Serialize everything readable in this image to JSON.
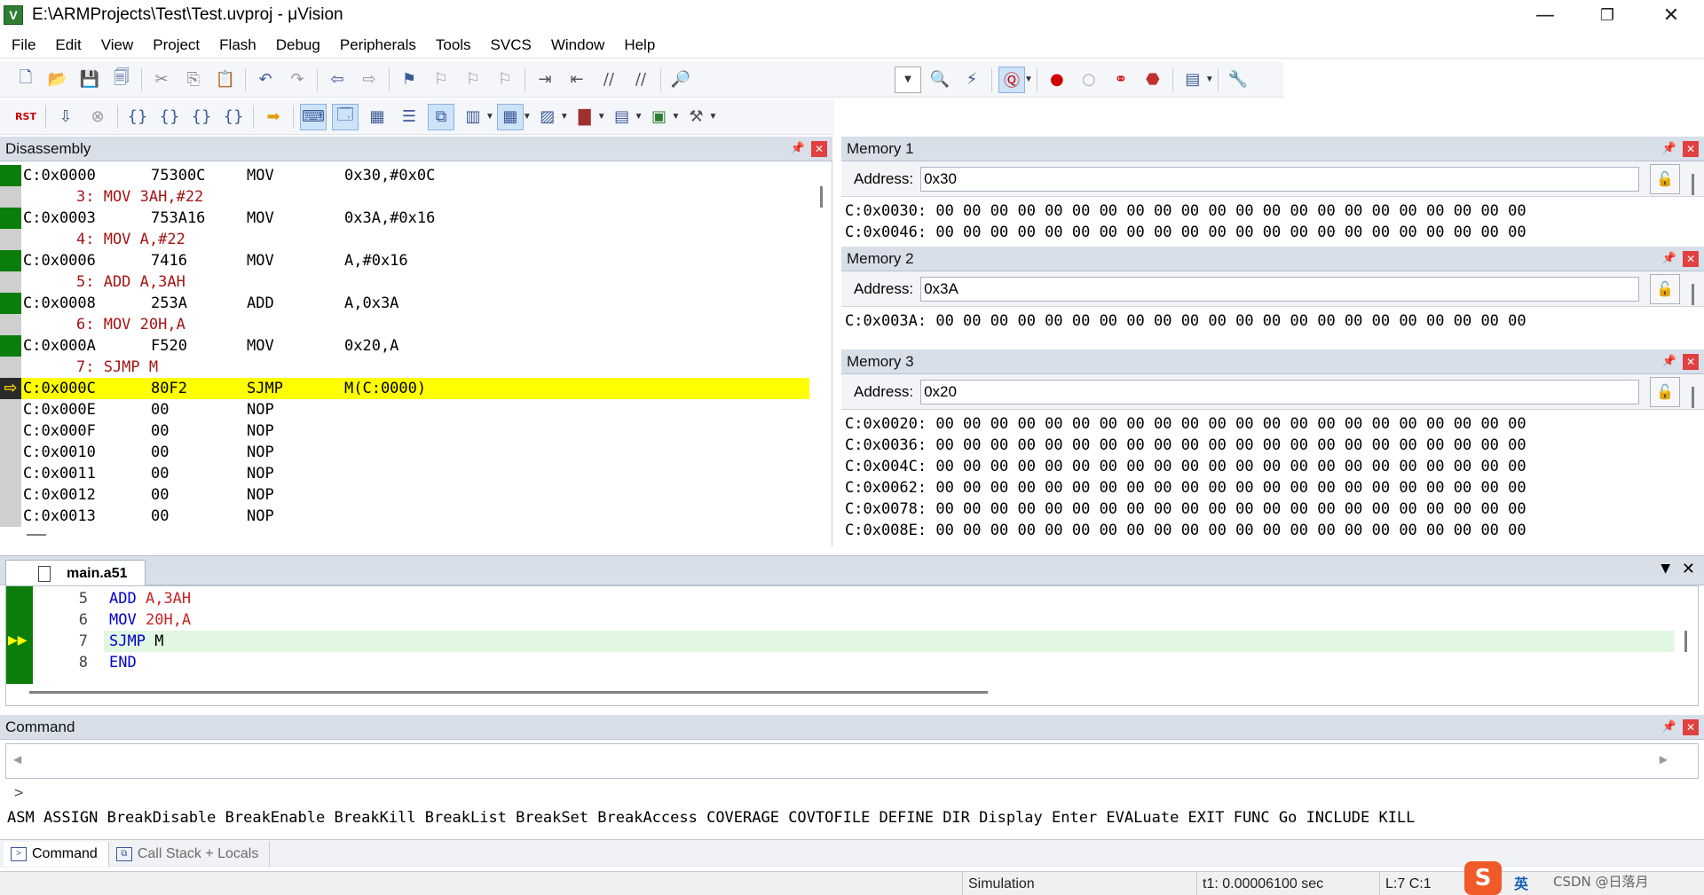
{
  "window": {
    "title": "E:\\ARMProjects\\Test\\Test.uvproj - μVision",
    "controls": {
      "minimize": "—",
      "maximize": "❐",
      "close": "✕"
    }
  },
  "menu": [
    "File",
    "Edit",
    "View",
    "Project",
    "Flash",
    "Debug",
    "Peripherals",
    "Tools",
    "SVCS",
    "Window",
    "Help"
  ],
  "disassembly": {
    "title": "Disassembly",
    "rows": [
      {
        "kind": "code",
        "addr": "C:0x0000",
        "bytes": "75300C",
        "mnem": "MOV",
        "ops": "0x30,#0x0C",
        "marker": "green"
      },
      {
        "kind": "src",
        "text": "3: MOV 3AH,#22"
      },
      {
        "kind": "code",
        "addr": "C:0x0003",
        "bytes": "753A16",
        "mnem": "MOV",
        "ops": "0x3A,#0x16",
        "marker": "green"
      },
      {
        "kind": "src",
        "text": "4: MOV A,#22"
      },
      {
        "kind": "code",
        "addr": "C:0x0006",
        "bytes": "7416",
        "mnem": "MOV",
        "ops": "A,#0x16",
        "marker": "green"
      },
      {
        "kind": "src",
        "text": "5: ADD A,3AH"
      },
      {
        "kind": "code",
        "addr": "C:0x0008",
        "bytes": "253A",
        "mnem": "ADD",
        "ops": "A,0x3A",
        "marker": "green"
      },
      {
        "kind": "src",
        "text": "6: MOV 20H,A"
      },
      {
        "kind": "code",
        "addr": "C:0x000A",
        "bytes": "F520",
        "mnem": "MOV",
        "ops": "0x20,A",
        "marker": "green"
      },
      {
        "kind": "src",
        "text": "7: SJMP M"
      },
      {
        "kind": "code",
        "addr": "C:0x000C",
        "bytes": "80F2",
        "mnem": "SJMP",
        "ops": "M(C:0000)",
        "marker": "current"
      },
      {
        "kind": "code",
        "addr": "C:0x000E",
        "bytes": "00",
        "mnem": "NOP",
        "ops": "",
        "marker": "none"
      },
      {
        "kind": "code",
        "addr": "C:0x000F",
        "bytes": "00",
        "mnem": "NOP",
        "ops": "",
        "marker": "none"
      },
      {
        "kind": "code",
        "addr": "C:0x0010",
        "bytes": "00",
        "mnem": "NOP",
        "ops": "",
        "marker": "none"
      },
      {
        "kind": "code",
        "addr": "C:0x0011",
        "bytes": "00",
        "mnem": "NOP",
        "ops": "",
        "marker": "none"
      },
      {
        "kind": "code",
        "addr": "C:0x0012",
        "bytes": "00",
        "mnem": "NOP",
        "ops": "",
        "marker": "none"
      },
      {
        "kind": "code",
        "addr": "C:0x0013",
        "bytes": "00",
        "mnem": "NOP",
        "ops": "",
        "marker": "none"
      }
    ]
  },
  "memory": [
    {
      "title": "Memory 1",
      "address_label": "Address:",
      "address": "0x30",
      "lines": [
        "C:0x0030: 00 00 00 00 00 00 00 00 00 00 00 00 00 00 00 00 00 00 00 00 00 00",
        "C:0x0046: 00 00 00 00 00 00 00 00 00 00 00 00 00 00 00 00 00 00 00 00 00 00"
      ]
    },
    {
      "title": "Memory 2",
      "address_label": "Address:",
      "address": "0x3A",
      "lines": [
        "C:0x003A: 00 00 00 00 00 00 00 00 00 00 00 00 00 00 00 00 00 00 00 00 00 00"
      ]
    },
    {
      "title": "Memory 3",
      "address_label": "Address:",
      "address": "0x20",
      "lines": [
        "C:0x0020: 00 00 00 00 00 00 00 00 00 00 00 00 00 00 00 00 00 00 00 00 00 00",
        "C:0x0036: 00 00 00 00 00 00 00 00 00 00 00 00 00 00 00 00 00 00 00 00 00 00",
        "C:0x004C: 00 00 00 00 00 00 00 00 00 00 00 00 00 00 00 00 00 00 00 00 00 00",
        "C:0x0062: 00 00 00 00 00 00 00 00 00 00 00 00 00 00 00 00 00 00 00 00 00 00",
        "C:0x0078: 00 00 00 00 00 00 00 00 00 00 00 00 00 00 00 00 00 00 00 00 00 00",
        "C:0x008E: 00 00 00 00 00 00 00 00 00 00 00 00 00 00 00 00 00 00 00 00 00 00"
      ]
    }
  ],
  "editor": {
    "tab": "main.a51",
    "lines": [
      {
        "num": "5",
        "op": "ADD",
        "args": "A,3AH",
        "arg_style": "arg"
      },
      {
        "num": "6",
        "op": "MOV",
        "args": "20H,A",
        "arg_style": "arg"
      },
      {
        "num": "7",
        "op": "SJMP",
        "args": "M",
        "arg_style": "plain",
        "current": true
      },
      {
        "num": "8",
        "op": "END",
        "args": "",
        "arg_style": "plain"
      }
    ]
  },
  "command": {
    "title": "Command",
    "prompt": ">",
    "hints": "ASM ASSIGN BreakDisable BreakEnable BreakKill BreakList BreakSet BreakAccess COVERAGE COVTOFILE DEFINE DIR Display Enter EVALuate EXIT FUNC Go INCLUDE KILL",
    "tabs": [
      "Command",
      "Call Stack + Locals"
    ]
  },
  "status": {
    "mode": "Simulation",
    "time": "t1: 0.00006100 sec",
    "position": "L:7 C:1",
    "ime": "英",
    "watermark": "CSDN @日落月"
  },
  "colors": {
    "current_line": "#ffff00",
    "exec_marker": "#0a7d0a",
    "source_text": "#a31515",
    "keyword_blue": "#0000cc",
    "panel_header": "#d8dfe9"
  }
}
